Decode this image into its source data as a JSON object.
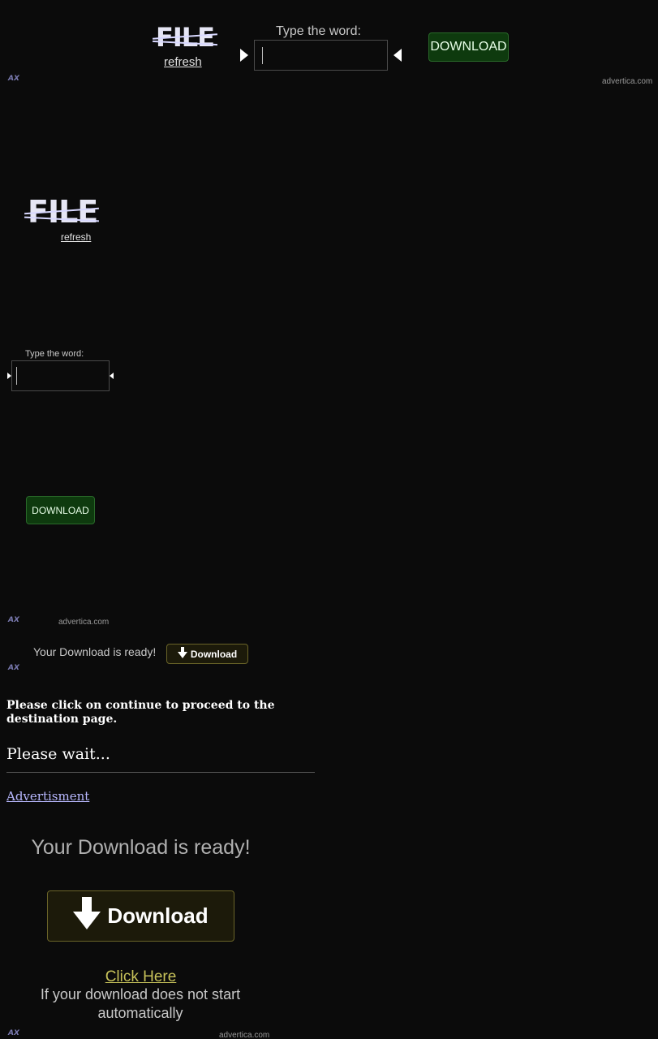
{
  "captcha_top": {
    "word": "FILE",
    "refresh": "refresh",
    "prompt": "Type the word:",
    "input_value": "",
    "button": "DOWNLOAD"
  },
  "ad_top": {
    "logo_text": "AX",
    "domain": "advertica.com"
  },
  "captcha_mid": {
    "word": "FILE",
    "refresh": "refresh",
    "prompt": "Type the word:",
    "input_value": "",
    "button": "DOWNLOAD"
  },
  "ad_mid": {
    "logo_text": "AX",
    "domain": "advertica.com"
  },
  "small_banner": {
    "text": "Your Download is ready!",
    "button": "Download"
  },
  "ad_small": {
    "logo_text": "AX"
  },
  "notice": {
    "heading": "Please click on continue to proceed to the destination page.",
    "wait": "Please wait...",
    "advert_link": "Advertisment"
  },
  "big_banner": {
    "title": "Your Download is ready!",
    "button": "Download",
    "click_here": "Click Here",
    "subtext": "If your download does not start automatically"
  },
  "ad_bottom": {
    "logo_text": "AX",
    "domain": "advertica.com"
  },
  "colors": {
    "background": "#0b0b0b",
    "green_button": "#0e3a0e",
    "gold_link": "#c7c25a"
  }
}
